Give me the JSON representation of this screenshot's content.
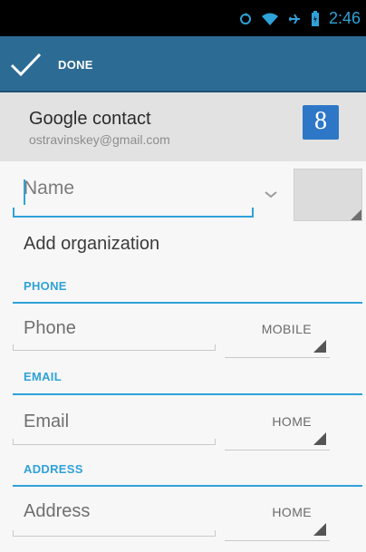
{
  "status_bar": {
    "time": "2:46",
    "icons": [
      "sync-icon",
      "wifi-icon",
      "airplane-icon",
      "battery-icon"
    ]
  },
  "action_bar": {
    "done_label": "DONE",
    "color": "#2c6b94"
  },
  "account": {
    "title": "Google contact",
    "email": "ostravinskey@gmail.com",
    "badge": "8"
  },
  "name_field": {
    "placeholder": "Name"
  },
  "add_organization": "Add organization",
  "sections": {
    "phone": {
      "header": "PHONE",
      "placeholder": "Phone",
      "type": "MOBILE"
    },
    "email": {
      "header": "EMAIL",
      "placeholder": "Email",
      "type": "HOME"
    },
    "address": {
      "header": "ADDRESS",
      "placeholder": "Address",
      "type": "HOME"
    }
  },
  "accent_color": "#2fa2d8"
}
